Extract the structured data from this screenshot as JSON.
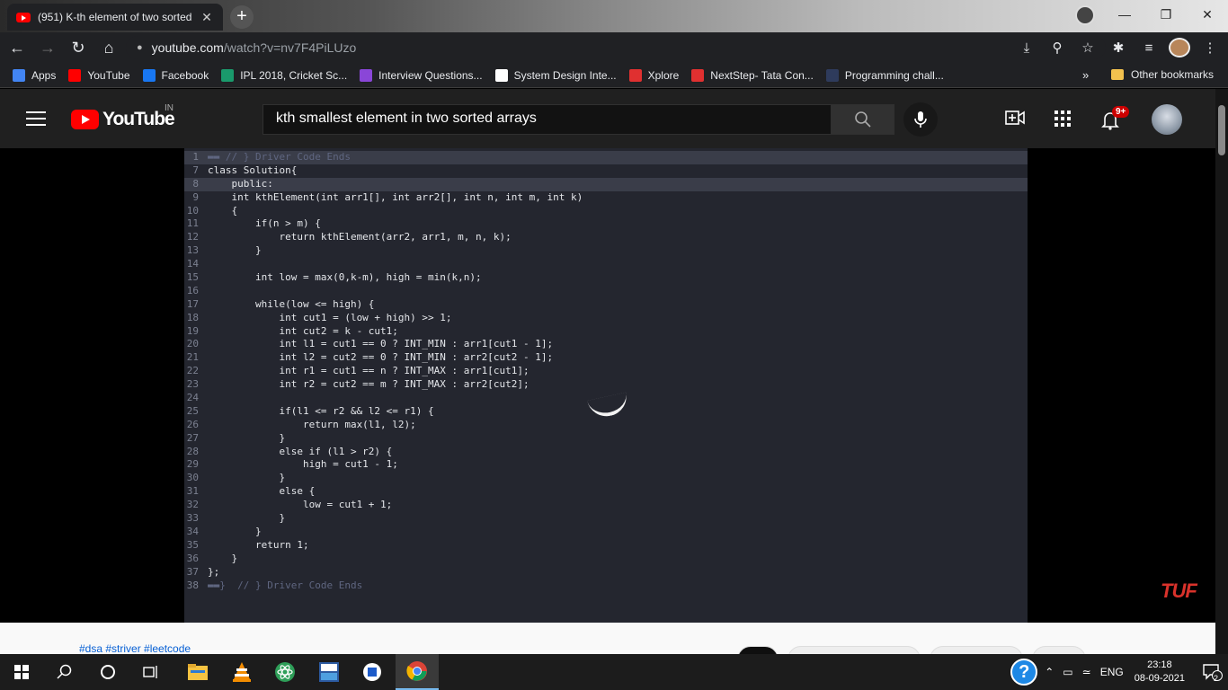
{
  "browser": {
    "tab_title": "(951) K-th element of two sorted",
    "tab_close": "✕",
    "new_tab": "+",
    "url_host": "youtube.com",
    "url_path": "/watch?v=nv7F4PiLUzo",
    "bookmarks": [
      {
        "label": "Apps",
        "icon": "apps-grid-icon",
        "color": "#4285f4"
      },
      {
        "label": "YouTube",
        "icon": "youtube-icon",
        "color": "#ff0000"
      },
      {
        "label": "Facebook",
        "icon": "facebook-icon",
        "color": "#1877f2"
      },
      {
        "label": "IPL 2018, Cricket Sc...",
        "icon": "cricbuzz-icon",
        "color": "#1a9a6c"
      },
      {
        "label": "Interview Questions...",
        "icon": "interview-icon",
        "color": "#8a46d8"
      },
      {
        "label": "System Design Inte...",
        "icon": "system-design-icon",
        "color": "#ffffff"
      },
      {
        "label": "Xplore",
        "icon": "tcs-icon",
        "color": "#e03030"
      },
      {
        "label": "NextStep- Tata Con...",
        "icon": "tcs-nextstep-icon",
        "color": "#e03030"
      },
      {
        "label": "Programming chall...",
        "icon": "hackerrank-icon",
        "color": "#2e3b5c"
      }
    ],
    "bookmarks_more": "»",
    "other_bookmarks": "Other bookmarks"
  },
  "youtube": {
    "logo_text": "YouTube",
    "country": "IN",
    "search_query": "kth smallest element in two sorted arrays",
    "notification_count": "9+",
    "hashtags": "#dsa #striver #leetcode"
  },
  "video": {
    "watermark": "TUF",
    "code_lines": [
      {
        "n": "1",
        "t": "▬▬ // } Driver Code Ends",
        "hl": true
      },
      {
        "n": "7",
        "t": "class Solution{",
        "hl": false
      },
      {
        "n": "8",
        "t": "    public:",
        "hl": true
      },
      {
        "n": "9",
        "t": "    int kthElement(int arr1[], int arr2[], int n, int m, int k)",
        "hl": false
      },
      {
        "n": "10",
        "t": "    {",
        "hl": false
      },
      {
        "n": "11",
        "t": "        if(n > m) {",
        "hl": false
      },
      {
        "n": "12",
        "t": "            return kthElement(arr2, arr1, m, n, k);",
        "hl": false
      },
      {
        "n": "13",
        "t": "        }",
        "hl": false
      },
      {
        "n": "14",
        "t": "",
        "hl": false
      },
      {
        "n": "15",
        "t": "        int low = max(0,k-m), high = min(k,n);",
        "hl": false
      },
      {
        "n": "16",
        "t": "",
        "hl": false
      },
      {
        "n": "17",
        "t": "        while(low <= high) {",
        "hl": false
      },
      {
        "n": "18",
        "t": "            int cut1 = (low + high) >> 1;",
        "hl": false
      },
      {
        "n": "19",
        "t": "            int cut2 = k - cut1;",
        "hl": false
      },
      {
        "n": "20",
        "t": "            int l1 = cut1 == 0 ? INT_MIN : arr1[cut1 - 1];",
        "hl": false
      },
      {
        "n": "21",
        "t": "            int l2 = cut2 == 0 ? INT_MIN : arr2[cut2 - 1];",
        "hl": false
      },
      {
        "n": "22",
        "t": "            int r1 = cut1 == n ? INT_MAX : arr1[cut1];",
        "hl": false
      },
      {
        "n": "23",
        "t": "            int r2 = cut2 == m ? INT_MAX : arr2[cut2];",
        "hl": false
      },
      {
        "n": "24",
        "t": "",
        "hl": false
      },
      {
        "n": "25",
        "t": "            if(l1 <= r2 && l2 <= r1) {",
        "hl": false
      },
      {
        "n": "26",
        "t": "                return max(l1, l2);",
        "hl": false
      },
      {
        "n": "27",
        "t": "            }",
        "hl": false
      },
      {
        "n": "28",
        "t": "            else if (l1 > r2) {",
        "hl": false
      },
      {
        "n": "29",
        "t": "                high = cut1 - 1;",
        "hl": false
      },
      {
        "n": "30",
        "t": "            }",
        "hl": false
      },
      {
        "n": "31",
        "t": "            else {",
        "hl": false
      },
      {
        "n": "32",
        "t": "                low = cut1 + 1;",
        "hl": false
      },
      {
        "n": "33",
        "t": "            }",
        "hl": false
      },
      {
        "n": "34",
        "t": "        }",
        "hl": false
      },
      {
        "n": "35",
        "t": "        return 1;",
        "hl": false
      },
      {
        "n": "36",
        "t": "    }",
        "hl": false
      },
      {
        "n": "37",
        "t": "};",
        "hl": false
      },
      {
        "n": "38",
        "t": "▬▬}  // } Driver Code Ends",
        "hl": false
      }
    ]
  },
  "taskbar": {
    "language": "ENG",
    "time": "23:18",
    "date": "08-09-2021",
    "notifications": "2"
  },
  "colors": {
    "yt_red": "#ff0000",
    "code_bg": "#24262f",
    "keyword": "#5ec8e0",
    "link": "#065fd4"
  }
}
